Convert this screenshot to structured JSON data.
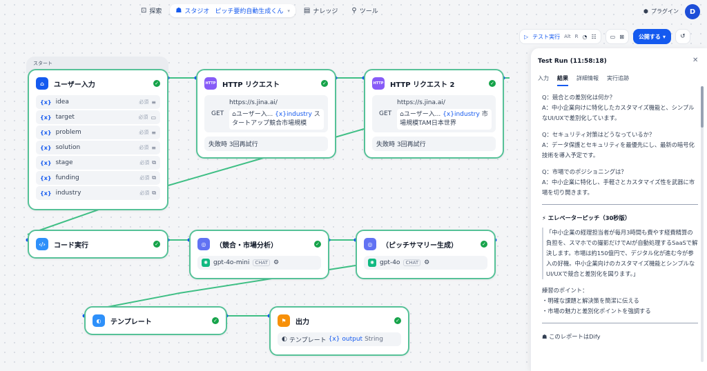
{
  "nav": {
    "explore": "探索",
    "studio": "スタジオ",
    "app_name": "ピッチ要約自動生成くん",
    "knowledge": "ナレッジ",
    "tools": "ツール",
    "plugins": "プラグイン",
    "avatar": "D"
  },
  "toolbar": {
    "test_run": "テスト実行",
    "shortcut_alt": "Alt",
    "shortcut_r": "R",
    "publish": "公開する"
  },
  "nodes": {
    "start_label": "スタート",
    "user_input": {
      "title": "ユーザー入力",
      "vars": [
        {
          "name": "idea",
          "req": "必須"
        },
        {
          "name": "target",
          "req": "必須"
        },
        {
          "name": "problem",
          "req": "必須"
        },
        {
          "name": "solution",
          "req": "必須"
        },
        {
          "name": "stage",
          "req": "必須"
        },
        {
          "name": "funding",
          "req": "必須"
        },
        {
          "name": "industry",
          "req": "必須"
        }
      ]
    },
    "http1": {
      "title": "HTTP リクエスト",
      "url": "https://s.jina.ai/",
      "method": "GET",
      "ref_src": "ユーザー入...",
      "ref_var": "industry",
      "tail": "スタートアップ競合市場規模",
      "retry": "失敗時 3回再試行"
    },
    "http2": {
      "title": "HTTP リクエスト 2",
      "url": "https://s.jina.ai/",
      "method": "GET",
      "ref_src": "ユーザー入...",
      "ref_var": "industry",
      "tail": "市場規模TAM日本世界",
      "retry": "失敗時 3回再試行"
    },
    "code": {
      "title": "コード実行"
    },
    "llm1": {
      "title": "（競合・市場分析）",
      "model": "gpt-4o-mini",
      "mode": "CHAT"
    },
    "llm2": {
      "title": "（ピッチサマリー生成）",
      "model": "gpt-4o",
      "mode": "CHAT"
    },
    "template": {
      "title": "テンプレート"
    },
    "output": {
      "title": "出力",
      "src": "テンプレート",
      "var": "output",
      "type": "String"
    }
  },
  "panel": {
    "title": "Test Run (11:58:18)",
    "tabs": [
      "入力",
      "結果",
      "詳細情報",
      "実行追跡"
    ],
    "active_tab": "結果",
    "qa": [
      {
        "q": "Q：競合との差別化は何か？",
        "a": "A：中小企業向けに特化したカスタマイズ機能と、シンプルなUI/UXで差別化しています。"
      },
      {
        "q": "Q：セキュリティ対策はどうなっているか？",
        "a": "A：データ保護とセキュリティを最優先にし、最新の暗号化技術を導入予定です。"
      },
      {
        "q": "Q：市場でのポジショニングは？",
        "a": "A：中小企業に特化し、手軽さとカスタマイズ性を武器に市場を切り開きます。"
      }
    ],
    "elevator_title": "エレベーターピッチ（30秒版）",
    "elevator_body": "「中小企業の経理担当者が毎月3時間も費やす経費精算の負担を、スマホでの撮影だけでAIが自動処理するSaaSで解決します。市場は約150億円で、デジタル化が進む今が参入の好機。中小企業向けのカスタマイズ機能とシンプルなUI/UXで競合と差別化を図ります。」",
    "points_title": "練習のポイント：",
    "points": [
      "・明確な課題と解決策を簡潔に伝える",
      "・市場の魅力と差別化ポイントを強調する"
    ],
    "footer": "このレポートはDify"
  },
  "colors": {
    "accent": "#155aef",
    "node_border": "#55c197",
    "success": "#16a34a"
  }
}
